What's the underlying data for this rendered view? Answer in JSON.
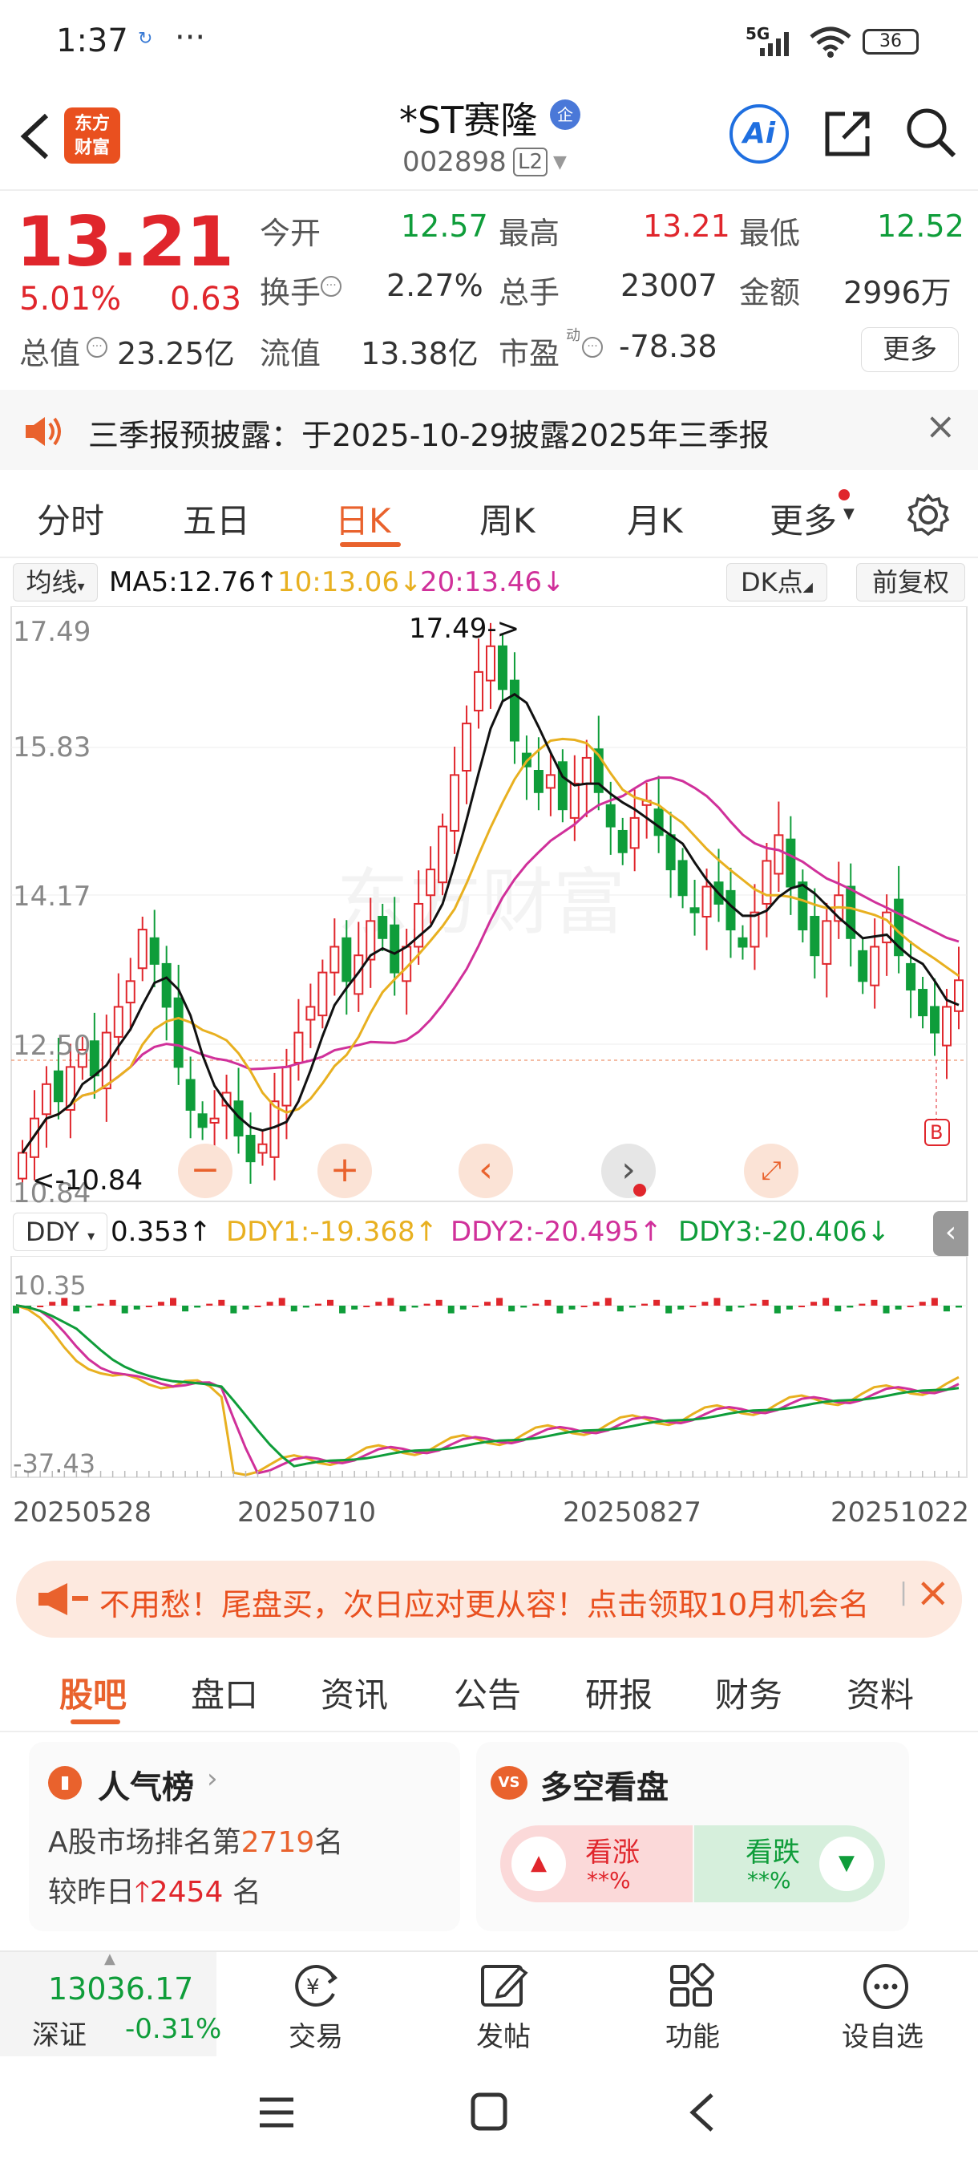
{
  "status": {
    "time": "1:37",
    "dots": "···",
    "net": "5G",
    "battery": "36"
  },
  "header": {
    "logo_line1": "东方",
    "logo_line2": "财富",
    "name": "*ST赛隆",
    "badge": "企",
    "code": "002898",
    "level": "L2",
    "ai_label": "Ai"
  },
  "quote": {
    "price": "13.21",
    "pct": "5.01%",
    "chg": "0.63",
    "open_label": "今开",
    "open": "12.57",
    "high_label": "最高",
    "high": "13.21",
    "low_label": "最低",
    "low": "12.52",
    "turnover_label": "换手",
    "turnover": "2.27%",
    "volume_label": "总手",
    "volume": "23007",
    "amount_label": "金额",
    "amount": "2996万",
    "mktcap_label": "总值",
    "mktcap": "23.25亿",
    "float_label": "流值",
    "float": "13.38亿",
    "pe_label": "市盈",
    "pe_sup": "动",
    "pe": "-78.38",
    "more": "更多"
  },
  "notice": {
    "text": "三季报预披露：于2025-10-29披露2025年三季报"
  },
  "tabs": [
    "分时",
    "五日",
    "日K",
    "周K",
    "月K",
    "更多"
  ],
  "ma": {
    "type": "均线",
    "ma5": "MA5:12.76",
    "ma10": "10:13.06",
    "ma20": "20:13.46",
    "dk": "DK点",
    "fq": "前复权"
  },
  "price_axis": [
    "17.49",
    "15.83",
    "14.17",
    "12.50",
    "10.84"
  ],
  "annot": {
    "high": "17.49->",
    "low": "<-10.84",
    "buy": "B"
  },
  "ddy": {
    "type": "DDY",
    "v0": "0.353",
    "v1": "DDY1:-19.368",
    "v2": "DDY2:-20.495",
    "v3": "DDY3:-20.406",
    "axis_top": "10.35",
    "axis_bot": "-37.43"
  },
  "dates": [
    "20250528",
    "20250710",
    "20250827",
    "20251022"
  ],
  "promo": {
    "text": "不用愁！尾盘买，次日应对更从容！点击领取10月机会名"
  },
  "sections": [
    "股吧",
    "盘口",
    "资讯",
    "公告",
    "研报",
    "财务",
    "资料"
  ],
  "pop": {
    "title": "人气榜",
    "rank_pre": "A股市场排名第",
    "rank": "2719",
    "rank_post": "名",
    "cmp_pre": "较昨日",
    "cmp": "2454",
    "cmp_post": " 名"
  },
  "ls": {
    "title": "多空看盘",
    "up": "看涨",
    "up_v": "**%",
    "down": "看跌",
    "down_v": "**%"
  },
  "bottom": {
    "index_val": "13036.17",
    "index_name": "深证",
    "index_chg": "-0.31%",
    "trade": "交易",
    "post": "发帖",
    "func": "功能",
    "watch": "设自选"
  },
  "colors": {
    "up": "#e0262c",
    "down": "#0f9d3a",
    "accent": "#e9622d",
    "ma5": "#111111",
    "ma10": "#e8b020",
    "ma20": "#d0309a"
  },
  "chart_data": {
    "type": "candlestick",
    "period": "daily",
    "x_range": [
      "20250528",
      "20251022"
    ],
    "ylim": [
      10.84,
      17.49
    ],
    "ma_series": [
      {
        "name": "MA5",
        "last": 12.76
      },
      {
        "name": "MA10",
        "last": 13.06
      },
      {
        "name": "MA20",
        "last": 13.46
      }
    ],
    "closes": [
      11.2,
      11.6,
      12.0,
      11.8,
      12.2,
      12.4,
      12.1,
      12.6,
      12.9,
      13.2,
      13.8,
      13.4,
      12.9,
      12.2,
      11.7,
      11.5,
      11.6,
      11.9,
      11.4,
      11.1,
      11.3,
      11.8,
      12.2,
      12.6,
      12.9,
      13.3,
      13.6,
      13.2,
      13.5,
      13.9,
      13.7,
      13.3,
      13.6,
      14.1,
      14.5,
      15.0,
      15.6,
      16.2,
      16.8,
      17.1,
      16.6,
      16.0,
      15.7,
      15.4,
      15.6,
      15.2,
      15.5,
      15.8,
      15.4,
      15.0,
      14.7,
      15.1,
      15.3,
      14.9,
      14.5,
      14.2,
      14.0,
      14.3,
      14.1,
      13.8,
      13.6,
      14.0,
      14.6,
      14.9,
      14.3,
      13.8,
      13.5,
      13.9,
      14.2,
      13.7,
      13.2,
      13.6,
      14.0,
      13.5,
      13.1,
      12.8,
      12.6,
      12.9,
      13.21
    ]
  }
}
